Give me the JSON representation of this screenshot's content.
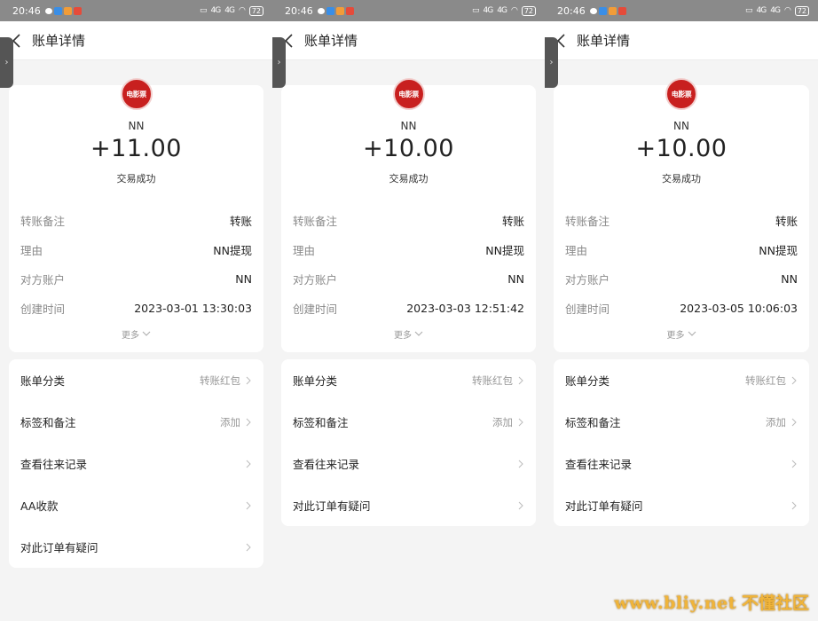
{
  "statusbar": {
    "time": "20:46",
    "battery": "72",
    "signal1": "4G",
    "signal2": "4G"
  },
  "navbar": {
    "title": "账单详情"
  },
  "merchant_logo_text": "电影票",
  "screens": [
    {
      "payee": "NN",
      "amount": "+11.00",
      "status": "交易成功",
      "details": [
        {
          "label": "转账备注",
          "value": "转账"
        },
        {
          "label": "理由",
          "value": "NN提现"
        },
        {
          "label": "对方账户",
          "value": "NN"
        },
        {
          "label": "创建时间",
          "value": "2023-03-01 13:30:03"
        }
      ],
      "more_label": "更多",
      "menu": [
        {
          "label": "账单分类",
          "value": "转账红包"
        },
        {
          "label": "标签和备注",
          "value": "添加"
        },
        {
          "label": "查看往来记录",
          "value": ""
        },
        {
          "label": "AA收款",
          "value": ""
        },
        {
          "label": "对此订单有疑问",
          "value": ""
        }
      ]
    },
    {
      "payee": "NN",
      "amount": "+10.00",
      "status": "交易成功",
      "details": [
        {
          "label": "转账备注",
          "value": "转账"
        },
        {
          "label": "理由",
          "value": "NN提现"
        },
        {
          "label": "对方账户",
          "value": "NN"
        },
        {
          "label": "创建时间",
          "value": "2023-03-03 12:51:42"
        }
      ],
      "more_label": "更多",
      "menu": [
        {
          "label": "账单分类",
          "value": "转账红包"
        },
        {
          "label": "标签和备注",
          "value": "添加"
        },
        {
          "label": "查看往来记录",
          "value": ""
        },
        {
          "label": "对此订单有疑问",
          "value": ""
        }
      ]
    },
    {
      "payee": "NN",
      "amount": "+10.00",
      "status": "交易成功",
      "details": [
        {
          "label": "转账备注",
          "value": "转账"
        },
        {
          "label": "理由",
          "value": "NN提现"
        },
        {
          "label": "对方账户",
          "value": "NN"
        },
        {
          "label": "创建时间",
          "value": "2023-03-05 10:06:03"
        }
      ],
      "more_label": "更多",
      "menu": [
        {
          "label": "账单分类",
          "value": "转账红包"
        },
        {
          "label": "标签和备注",
          "value": "添加"
        },
        {
          "label": "查看往来记录",
          "value": ""
        },
        {
          "label": "对此订单有疑问",
          "value": ""
        }
      ]
    }
  ],
  "watermark": {
    "url": "www.bliy.net",
    "text": "不懂社区"
  }
}
